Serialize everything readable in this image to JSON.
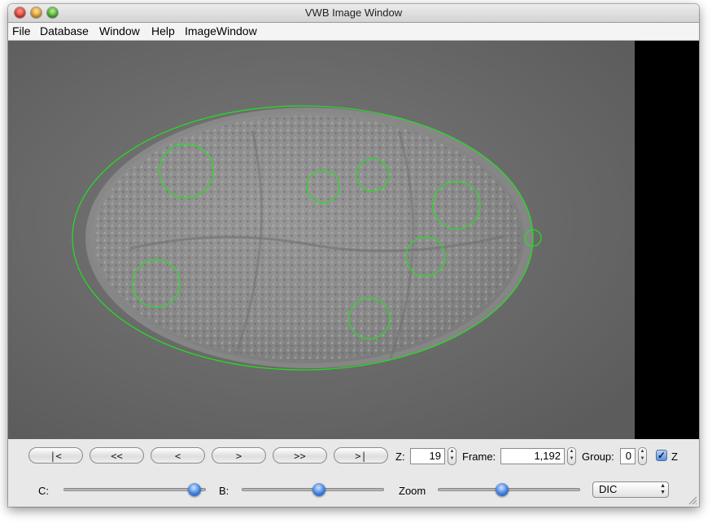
{
  "window": {
    "title": "VWB Image Window"
  },
  "menubar": {
    "items": [
      "File",
      "Database",
      "Window",
      "Help",
      "ImageWindow"
    ]
  },
  "navigation": {
    "buttons": [
      "|<",
      "<<",
      "<",
      ">",
      ">>",
      ">|"
    ]
  },
  "fields": {
    "z": {
      "label": "Z:",
      "value": "19"
    },
    "frame": {
      "label": "Frame:",
      "value": "1,192"
    },
    "group": {
      "label": "Group:",
      "value": "0"
    },
    "z_checkbox": {
      "label": "Z",
      "checked": true
    }
  },
  "sliders": {
    "c": {
      "label": "C:",
      "value": 0.92
    },
    "b": {
      "label": "B:",
      "value": 0.54
    },
    "zoom": {
      "label": "Zoom",
      "value": 0.45
    }
  },
  "channel_select": {
    "value": "DIC"
  },
  "overlay": {
    "color": "#22e022"
  }
}
